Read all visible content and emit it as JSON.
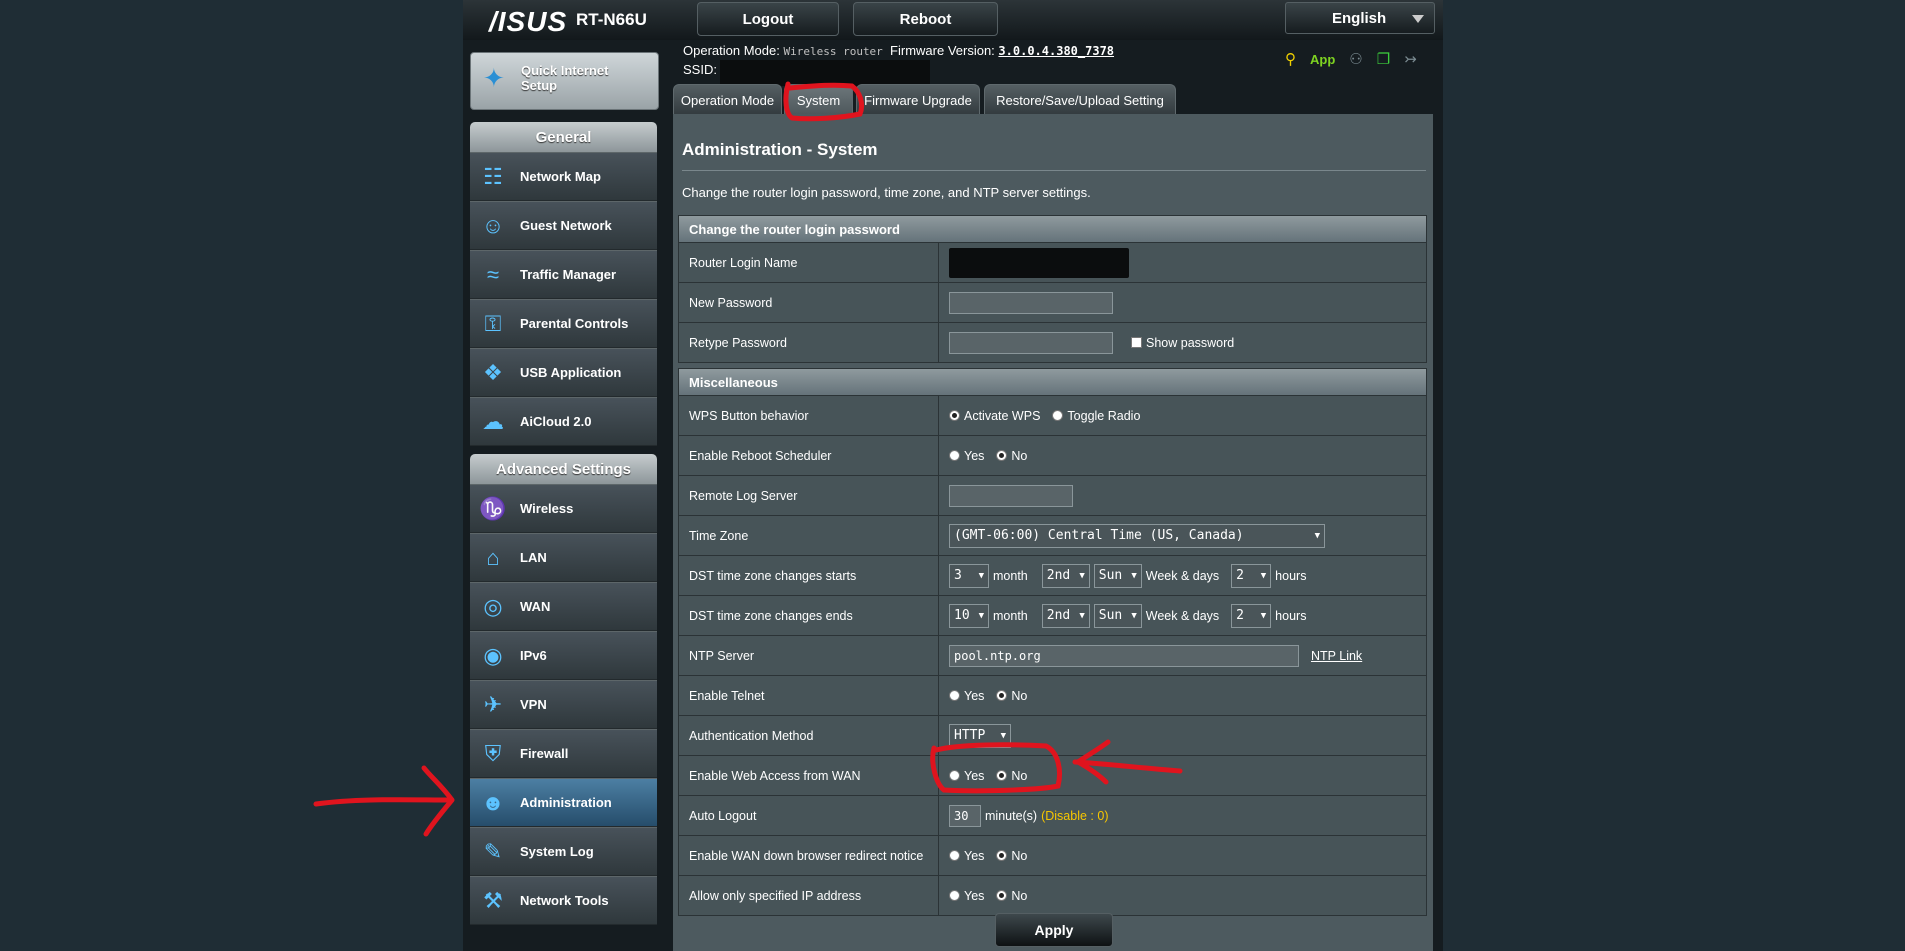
{
  "header": {
    "brand": "/ISUS",
    "model": "RT-N66U",
    "logout_label": "Logout",
    "reboot_label": "Reboot",
    "language": "English"
  },
  "status": {
    "op_mode_label": "Operation Mode:",
    "op_mode_value": "Wireless router",
    "fw_label": "Firmware Version:",
    "fw_value": "3.0.0.4.380_7378",
    "ssid_label": "SSID:",
    "app_label": "App"
  },
  "sidebar": {
    "qis_label": "Quick Internet Setup",
    "general_title": "General",
    "general_items": [
      {
        "label": "Network Map",
        "icon": "network-map-icon"
      },
      {
        "label": "Guest Network",
        "icon": "guest-network-icon"
      },
      {
        "label": "Traffic Manager",
        "icon": "traffic-manager-icon"
      },
      {
        "label": "Parental Controls",
        "icon": "lock-icon"
      },
      {
        "label": "USB Application",
        "icon": "puzzle-icon"
      },
      {
        "label": "AiCloud 2.0",
        "icon": "cloud-icon"
      }
    ],
    "advanced_title": "Advanced Settings",
    "advanced_items": [
      {
        "label": "Wireless",
        "icon": "wifi-icon"
      },
      {
        "label": "LAN",
        "icon": "home-icon"
      },
      {
        "label": "WAN",
        "icon": "globe-icon"
      },
      {
        "label": "IPv6",
        "icon": "ipv6-icon"
      },
      {
        "label": "VPN",
        "icon": "vpn-icon"
      },
      {
        "label": "Firewall",
        "icon": "shield-icon"
      },
      {
        "label": "Administration",
        "icon": "user-icon",
        "active": true
      },
      {
        "label": "System Log",
        "icon": "log-icon"
      },
      {
        "label": "Network Tools",
        "icon": "tools-icon"
      }
    ]
  },
  "tabs": [
    "Operation Mode",
    "System",
    "Firmware Upgrade",
    "Restore/Save/Upload Setting"
  ],
  "page": {
    "title": "Administration - System",
    "description": "Change the router login password, time zone, and NTP server settings."
  },
  "login_group": {
    "title": "Change the router login password",
    "login_name_label": "Router Login Name",
    "new_password_label": "New Password",
    "retype_password_label": "Retype Password",
    "show_password_label": "Show password"
  },
  "misc_group": {
    "title": "Miscellaneous",
    "wps_label": "WPS Button behavior",
    "wps_opt1": "Activate WPS",
    "wps_opt2": "Toggle Radio",
    "reboot_sched_label": "Enable Reboot Scheduler",
    "remote_log_label": "Remote Log Server",
    "timezone_label": "Time Zone",
    "timezone_value": "(GMT-06:00) Central Time (US, Canada)",
    "dst_start_label": "DST time zone changes starts",
    "dst_start": {
      "month": "3",
      "week": "2nd",
      "day": "Sun",
      "hour": "2"
    },
    "dst_end_label": "DST time zone changes ends",
    "dst_end": {
      "month": "10",
      "week": "2nd",
      "day": "Sun",
      "hour": "2"
    },
    "month_text": "month",
    "weekdays_text": "Week & days",
    "hours_text": "hours",
    "ntp_label": "NTP Server",
    "ntp_value": "pool.ntp.org",
    "ntp_link": "NTP Link",
    "telnet_label": "Enable Telnet",
    "auth_label": "Authentication Method",
    "auth_value": "HTTP",
    "web_wan_label": "Enable Web Access from WAN",
    "auto_logout_label": "Auto Logout",
    "auto_logout_value": "30",
    "auto_logout_unit": "minute(s)",
    "auto_logout_hint": "(Disable : 0)",
    "wan_redirect_label": "Enable WAN down browser redirect notice",
    "ip_only_label": "Allow only specified IP address",
    "yes": "Yes",
    "no": "No"
  },
  "apply_label": "Apply",
  "colors": {
    "annotation": "#e0141e",
    "accent": "#5cc3ff",
    "hint": "#f7c600"
  }
}
